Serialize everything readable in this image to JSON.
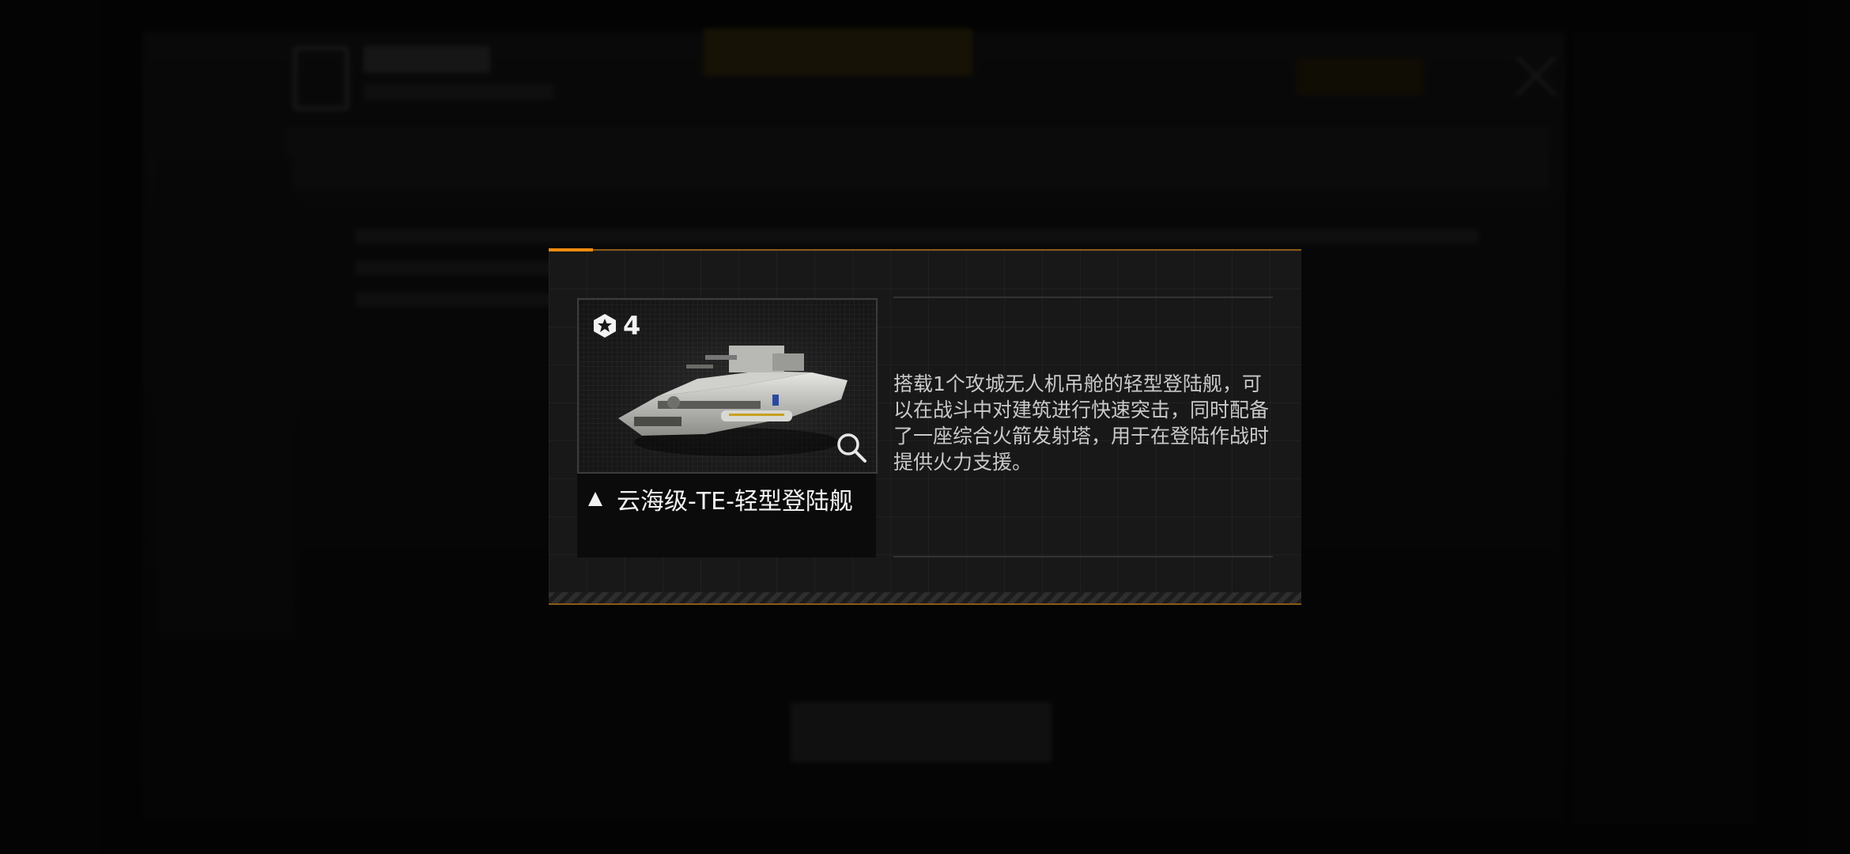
{
  "item_dialog": {
    "tier_icon": "tier-emblem-icon",
    "tier_value": "4",
    "rank_icon": "triangle-up-icon",
    "name": "云海级-TE-轻型登陆舰",
    "description": "搭载1个攻城无人机吊舱的轻型登陆舰，可以在战斗中对建筑进行快速突击，同时配备了一座综合火箭发射塔，用于在登陆作战时提供火力支援。",
    "zoom_icon": "magnifier-icon"
  },
  "colors": {
    "accent": "#f08a10",
    "text": "#f4f4f4",
    "description_text": "#c9c9c9",
    "modal_background": "#181818"
  }
}
